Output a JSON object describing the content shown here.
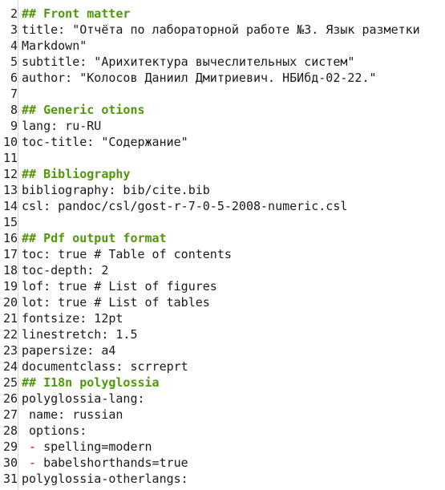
{
  "editor": {
    "lines": [
      {
        "num": "2",
        "text": "## Front matter",
        "kind": "heading"
      },
      {
        "num": "3",
        "text": "title: \"Отчёта по лабораторной работе №3. Язык разметки",
        "kind": "plain"
      },
      {
        "num": "4",
        "text": "Markdown\"",
        "kind": "plain"
      },
      {
        "num": "5",
        "text": "subtitle: \"Арихитектура вычеслительных систем\"",
        "kind": "plain"
      },
      {
        "num": "6",
        "text": "author: \"Колосов Даниил Дмитриевич. НБИбд-02-22.\"",
        "kind": "plain"
      },
      {
        "num": "7",
        "text": "",
        "kind": "plain"
      },
      {
        "num": "8",
        "text": "## Generic otions",
        "kind": "heading"
      },
      {
        "num": "9",
        "text": "lang: ru-RU",
        "kind": "plain"
      },
      {
        "num": "10",
        "text": "toc-title: \"Содержание\"",
        "kind": "plain"
      },
      {
        "num": "11",
        "text": "",
        "kind": "plain"
      },
      {
        "num": "12",
        "text": "## Bibliography",
        "kind": "heading"
      },
      {
        "num": "13",
        "text": "bibliography: bib/cite.bib",
        "kind": "plain"
      },
      {
        "num": "14",
        "text": "csl: pandoc/csl/gost-r-7-0-5-2008-numeric.csl",
        "kind": "plain"
      },
      {
        "num": "15",
        "text": "",
        "kind": "plain"
      },
      {
        "num": "16",
        "text": "## Pdf output format",
        "kind": "heading"
      },
      {
        "num": "17",
        "text": "toc: true # Table of contents",
        "kind": "plain"
      },
      {
        "num": "18",
        "text": "toc-depth: 2",
        "kind": "plain"
      },
      {
        "num": "19",
        "text": "lof: true # List of figures",
        "kind": "plain"
      },
      {
        "num": "20",
        "text": "lot: true # List of tables",
        "kind": "plain"
      },
      {
        "num": "21",
        "text": "fontsize: 12pt",
        "kind": "plain"
      },
      {
        "num": "22",
        "text": "linestretch: 1.5",
        "kind": "plain"
      },
      {
        "num": "23",
        "text": "papersize: a4",
        "kind": "plain"
      },
      {
        "num": "24",
        "text": "documentclass: scrreprt",
        "kind": "plain"
      },
      {
        "num": "25",
        "text": "## I18n polyglossia",
        "kind": "heading"
      },
      {
        "num": "26",
        "text": "polyglossia-lang:",
        "kind": "plain"
      },
      {
        "num": "27",
        "text": " name: russian",
        "kind": "plain"
      },
      {
        "num": "28",
        "text": " options:",
        "kind": "plain"
      },
      {
        "num": "29",
        "text": "spelling=modern",
        "kind": "list",
        "dash": " - "
      },
      {
        "num": "30",
        "text": "babelshorthands=true",
        "kind": "list",
        "dash": " - "
      },
      {
        "num": "31",
        "text": "polyglossia-otherlangs:",
        "kind": "plain"
      }
    ],
    "colors": {
      "heading": "#4e9a06",
      "list_dash": "#cc0000",
      "text": "#1a1a1a"
    }
  }
}
